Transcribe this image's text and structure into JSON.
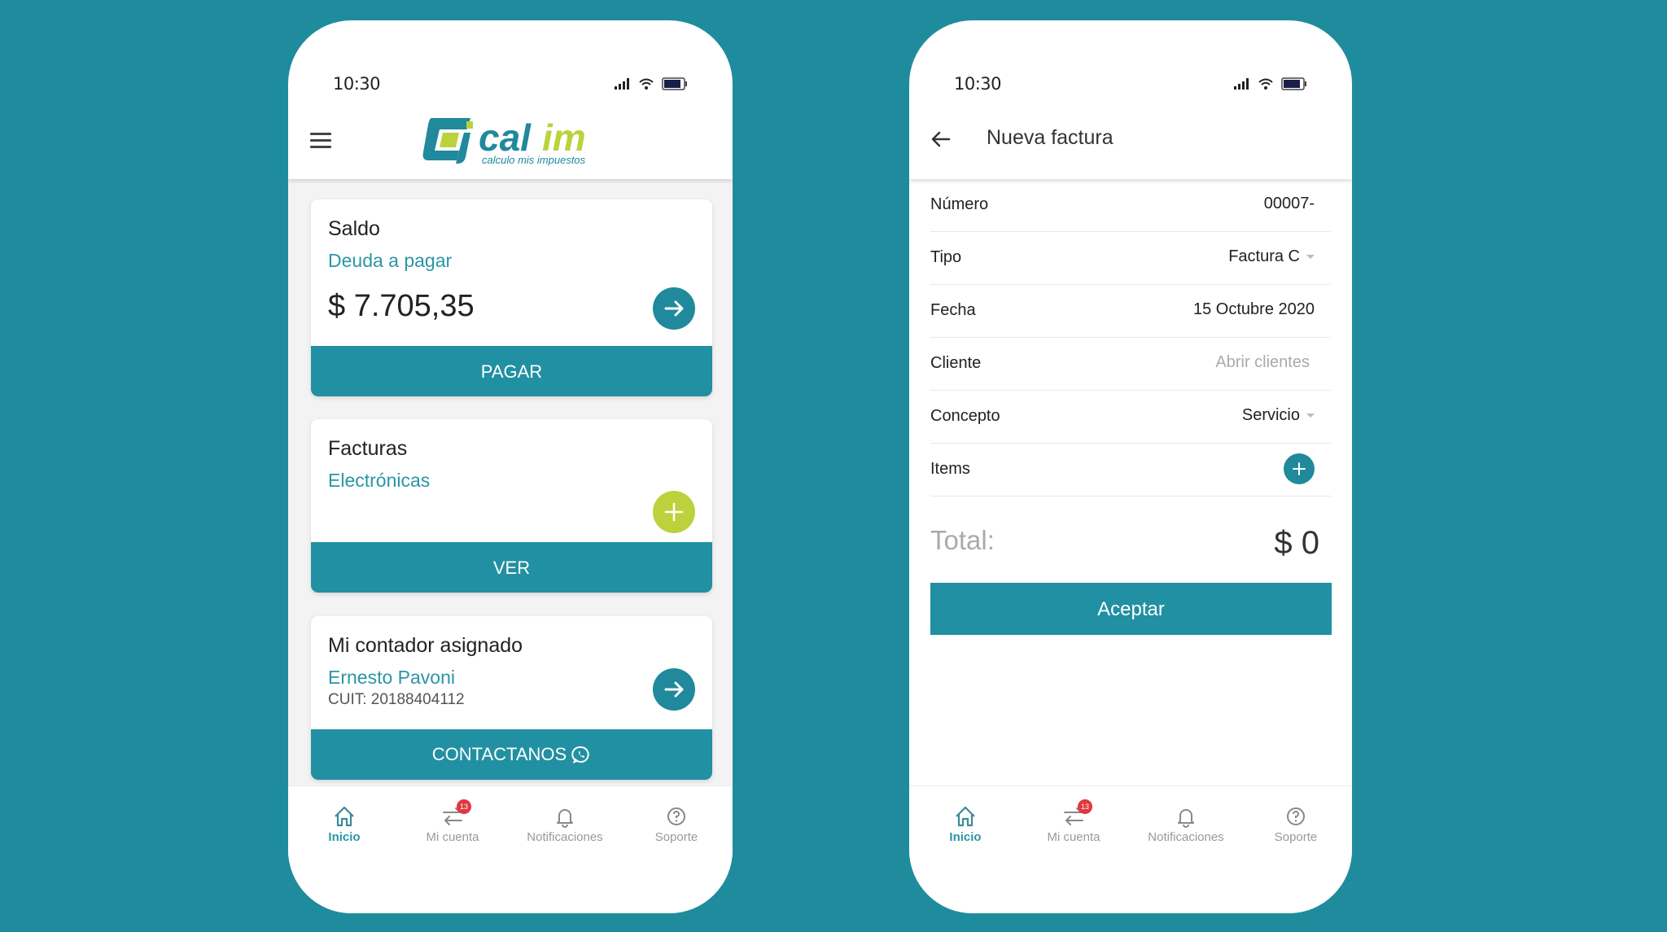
{
  "colors": {
    "background": "#1f8c9e",
    "primary": "#2190a2",
    "accent_lime": "#bcd23c",
    "badge": "#e0383f"
  },
  "left_phone": {
    "status_bar": {
      "time": "10:30",
      "icons": [
        "signal-icon",
        "wifi-icon",
        "battery-icon"
      ]
    },
    "header": {
      "menu_icon": "hamburger-menu-icon",
      "logo": {
        "brand": "calim",
        "brand_part1": "cal",
        "brand_part2": "im",
        "tagline": "calculo mis impuestos"
      }
    },
    "cards": {
      "saldo": {
        "title": "Saldo",
        "subtitle": "Deuda a pagar",
        "amount": "$ 7.705,35",
        "button": "PAGAR",
        "icon": "arrow-right-icon"
      },
      "facturas": {
        "title": "Facturas",
        "subtitle": "Electrónicas",
        "button": "VER",
        "icon": "plus-icon"
      },
      "contador": {
        "title": "Mi contador asignado",
        "name": "Ernesto Pavoni",
        "cuit": "CUIT: 20188404112",
        "button": "CONTACTANOS",
        "icon": "arrow-right-icon",
        "button_icon": "whatsapp-icon"
      }
    },
    "bottom_nav": [
      {
        "label": "Inicio",
        "icon": "home-icon",
        "active": true
      },
      {
        "label": "Mi cuenta",
        "icon": "transfer-arrows-icon",
        "badge": "13"
      },
      {
        "label": "Notificaciones",
        "icon": "bell-icon"
      },
      {
        "label": "Soporte",
        "icon": "help-circle-icon"
      }
    ]
  },
  "right_phone": {
    "status_bar": {
      "time": "10:30",
      "icons": [
        "signal-icon",
        "wifi-icon",
        "battery-icon"
      ]
    },
    "header": {
      "back_icon": "arrow-left-icon",
      "title": "Nueva factura"
    },
    "form": {
      "rows": [
        {
          "label": "Número",
          "value": "00007-"
        },
        {
          "label": "Tipo",
          "value": "Factura C",
          "dropdown": true
        },
        {
          "label": "Fecha",
          "value": "15 Octubre 2020"
        },
        {
          "label": "Cliente",
          "placeholder": "Abrir clientes"
        },
        {
          "label": "Concepto",
          "value": "Servicio",
          "dropdown": true
        },
        {
          "label": "Items",
          "action_icon": "plus-icon"
        }
      ],
      "total_label": "Total:",
      "total_value": "$ 0",
      "accept_button": "Aceptar"
    },
    "bottom_nav": [
      {
        "label": "Inicio",
        "icon": "home-icon",
        "active": true
      },
      {
        "label": "Mi cuenta",
        "icon": "transfer-arrows-icon",
        "badge": "13"
      },
      {
        "label": "Notificaciones",
        "icon": "bell-icon"
      },
      {
        "label": "Soporte",
        "icon": "help-circle-icon"
      }
    ]
  }
}
